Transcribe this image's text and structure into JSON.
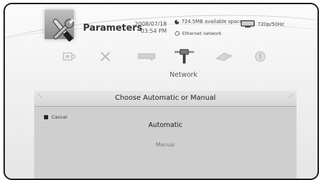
{
  "header": {
    "category_title": "Parameters",
    "date": "2008/07/18",
    "time": "03:54 PM",
    "storage": "724.5MB available space",
    "network_status": "Ethernet network",
    "video_mode": "720p/50Hz"
  },
  "icon_row": {
    "items": [
      {
        "name": "system-settings-icon"
      },
      {
        "name": "tools-icon"
      },
      {
        "name": "display-settings-icon"
      },
      {
        "name": "network-icon"
      },
      {
        "name": "video-settings-icon"
      },
      {
        "name": "info-icon"
      }
    ],
    "selected_label": "Network"
  },
  "dialog": {
    "title": "Choose Automatic or Manual",
    "cancel_label": "Cancel",
    "options": [
      "Automatic",
      "Manual"
    ],
    "selected_option": "Automatic"
  }
}
